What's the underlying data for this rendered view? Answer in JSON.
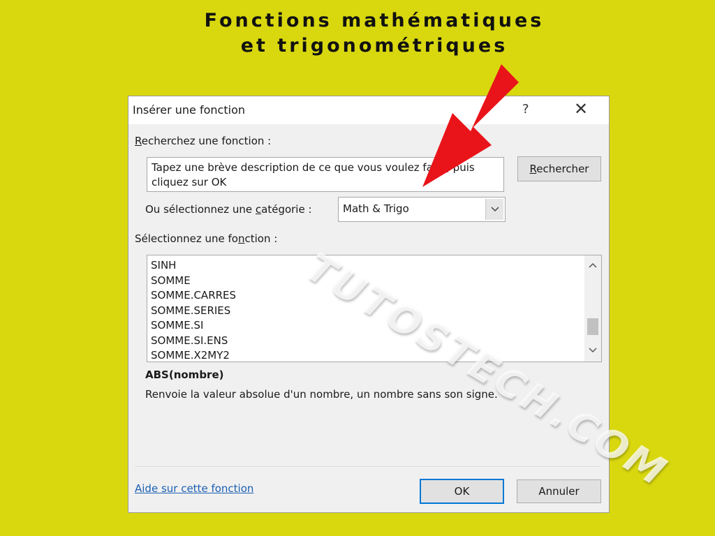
{
  "banner": {
    "line1": "Fonctions mathématiques",
    "line2": "et trigonométriques"
  },
  "watermark": "TUTOSTECH.COM",
  "dialog": {
    "title": "Insérer une fonction",
    "help_glyph": "?",
    "close_glyph": "✕",
    "search_label_accel": "R",
    "search_label_rest": "echerchez une fonction :",
    "search_input_value": "Tapez une brève description de ce que vous voulez faire, puis cliquez sur OK",
    "search_button_accel": "R",
    "search_button_rest": "echercher",
    "category_label_pre": "Ou sélectionnez une ",
    "category_label_accel": "c",
    "category_label_post": "atégorie :",
    "category_value": "Math & Trigo",
    "function_label_pre": "Sélectionnez une fo",
    "function_label_accel": "n",
    "function_label_post": "ction :",
    "functions": [
      "SINH",
      "SOMME",
      "SOMME.CARRES",
      "SOMME.SERIES",
      "SOMME.SI",
      "SOMME.SI.ENS",
      "SOMME.X2MY2"
    ],
    "signature": "ABS(nombre)",
    "description": "Renvoie la valeur absolue d'un nombre, un nombre sans son signe.",
    "help_link": "Aide sur cette fonction",
    "ok_label": "OK",
    "cancel_label": "Annuler"
  },
  "icons": {
    "dropdown": "chevron-down-icon",
    "scroll_up": "chevron-up-icon",
    "scroll_down": "chevron-down-icon",
    "arrow": "red-arrow-icon"
  },
  "colors": {
    "background": "#d9d80f",
    "arrow": "#e8141a",
    "link": "#1a5fb4",
    "ok_border": "#0078d7"
  }
}
